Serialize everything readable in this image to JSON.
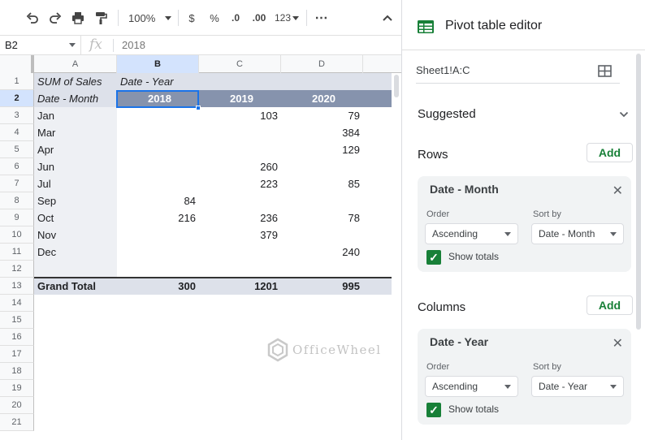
{
  "toolbar": {
    "zoom": "100%",
    "currency": "$",
    "percent": "%",
    "dec_decrease": ".0",
    "dec_increase": ".00",
    "format_more": "123"
  },
  "formula_bar": {
    "cell_ref": "B2",
    "fx": "fx",
    "value": "2018"
  },
  "grid": {
    "columns": [
      "A",
      "B",
      "C",
      "D"
    ],
    "rows": [
      {
        "num": "1",
        "a": "SUM of Sales",
        "b": "Date - Year",
        "c": "",
        "d": ""
      },
      {
        "num": "2",
        "a": "Date - Month",
        "b": "2018",
        "c": "2019",
        "d": "2020"
      },
      {
        "num": "3",
        "a": "Jan",
        "b": "",
        "c": "103",
        "d": "79"
      },
      {
        "num": "4",
        "a": "Mar",
        "b": "",
        "c": "",
        "d": "384"
      },
      {
        "num": "5",
        "a": "Apr",
        "b": "",
        "c": "",
        "d": "129"
      },
      {
        "num": "6",
        "a": "Jun",
        "b": "",
        "c": "260",
        "d": ""
      },
      {
        "num": "7",
        "a": "Jul",
        "b": "",
        "c": "223",
        "d": "85"
      },
      {
        "num": "8",
        "a": "Sep",
        "b": "84",
        "c": "",
        "d": ""
      },
      {
        "num": "9",
        "a": "Oct",
        "b": "216",
        "c": "236",
        "d": "78"
      },
      {
        "num": "10",
        "a": "Nov",
        "b": "",
        "c": "379",
        "d": ""
      },
      {
        "num": "11",
        "a": "Dec",
        "b": "",
        "c": "",
        "d": "240"
      },
      {
        "num": "12",
        "a": "",
        "b": "",
        "c": "",
        "d": ""
      },
      {
        "num": "13",
        "a": "Grand Total",
        "b": "300",
        "c": "1201",
        "d": "995"
      },
      {
        "num": "14",
        "a": "",
        "b": "",
        "c": "",
        "d": ""
      },
      {
        "num": "15",
        "a": "",
        "b": "",
        "c": "",
        "d": ""
      },
      {
        "num": "16",
        "a": "",
        "b": "",
        "c": "",
        "d": ""
      },
      {
        "num": "17",
        "a": "",
        "b": "",
        "c": "",
        "d": ""
      },
      {
        "num": "18",
        "a": "",
        "b": "",
        "c": "",
        "d": ""
      },
      {
        "num": "19",
        "a": "",
        "b": "",
        "c": "",
        "d": ""
      },
      {
        "num": "20",
        "a": "",
        "b": "",
        "c": "",
        "d": ""
      },
      {
        "num": "21",
        "a": "",
        "b": "",
        "c": "",
        "d": ""
      }
    ],
    "selected_cell": "B2"
  },
  "watermark": "OfficeWheel",
  "panel": {
    "title": "Pivot table editor",
    "range": "Sheet1!A:C",
    "suggested_label": "Suggested",
    "rows_label": "Rows",
    "columns_label": "Columns",
    "add_label": "Add",
    "row_card": {
      "title": "Date - Month",
      "order_label": "Order",
      "order_value": "Ascending",
      "sortby_label": "Sort by",
      "sortby_value": "Date - Month",
      "show_totals": "Show totals"
    },
    "column_card": {
      "title": "Date - Year",
      "order_label": "Order",
      "order_value": "Ascending",
      "sortby_label": "Sort by",
      "sortby_value": "Date - Year",
      "show_totals": "Show totals"
    }
  },
  "colors": {
    "pivot_header_bg": "#dde1ea",
    "pivot_year_bg": "#8693ad",
    "grand_total_bg": "#dde1ea",
    "accent_green": "#188038",
    "selection_blue": "#1a73e8"
  }
}
